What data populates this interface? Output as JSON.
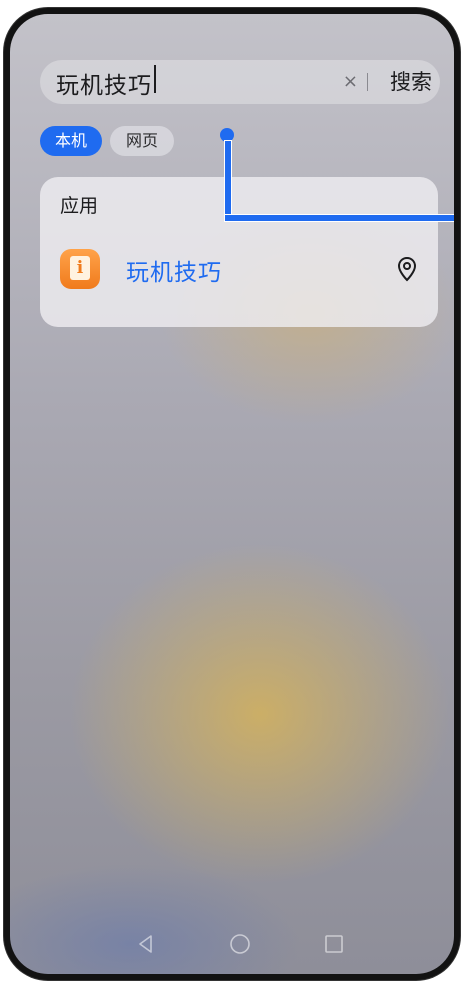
{
  "search": {
    "query": "玩机技巧",
    "clear_symbol": "×",
    "submit_label": "搜索"
  },
  "filters": [
    {
      "label": "本机",
      "selected": true
    },
    {
      "label": "网页",
      "selected": false
    }
  ],
  "results": {
    "section_title": "应用",
    "items": [
      {
        "label": "玩机技巧",
        "icon": "tips-app-icon",
        "icon_glyph": "i",
        "action_icon": "location-icon"
      }
    ]
  },
  "colors": {
    "accent": "#1f6bf0",
    "app_icon": "#f07b1c"
  },
  "navigation": {
    "icons": [
      "back-icon",
      "home-icon",
      "recent-apps-icon"
    ]
  }
}
